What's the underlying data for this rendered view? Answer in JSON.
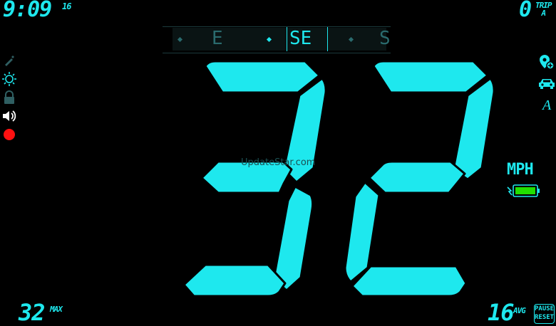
{
  "clock": {
    "time": "9:09",
    "seconds": "16"
  },
  "trip": {
    "value": "0",
    "label_line1": "TRIP",
    "label_line2": "A"
  },
  "compass": {
    "marks": [
      "E",
      "SE",
      "S"
    ],
    "current": "SE"
  },
  "speed": {
    "value": "32",
    "unit": "MPH",
    "battery_level": 1.0
  },
  "watermark": "UpdateStar.com",
  "stats": {
    "max_value": "32",
    "max_label": "MAX",
    "avg_value": "16",
    "avg_label": "AVG"
  },
  "pause_button": {
    "line1": "PAUSE",
    "line2": "RESET"
  },
  "colors": {
    "accent": "#1ee8ee",
    "background": "#000000",
    "battery": "#22e000",
    "record": "#ff1111"
  },
  "icons": {
    "left": [
      "pen-off-icon",
      "brightness-icon",
      "lock-icon",
      "volume-icon",
      "record-icon"
    ],
    "right": [
      "location-pin-icon",
      "car-icon",
      "font-icon"
    ]
  }
}
